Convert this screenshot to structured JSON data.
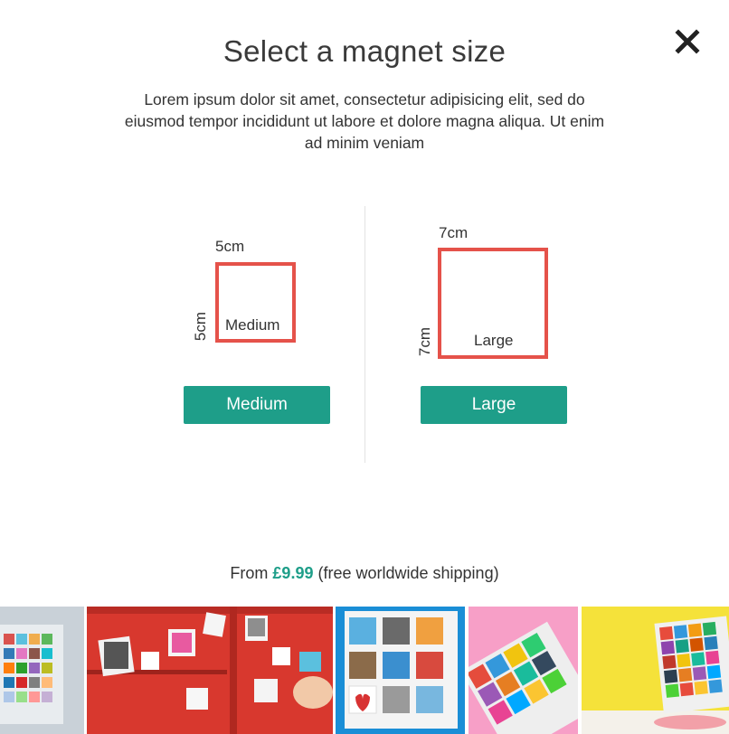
{
  "modal": {
    "title": "Select a magnet size",
    "description": "Lorem ipsum dolor sit amet, consectetur adipisicing elit, sed do eiusmod tempor incididunt ut labore et dolore magna aliqua. Ut enim ad minim veniam"
  },
  "options": {
    "medium": {
      "width_label": "5cm",
      "height_label": "5cm",
      "box_label": "Medium",
      "button_label": "Medium"
    },
    "large": {
      "width_label": "7cm",
      "height_label": "7cm",
      "box_label": "Large",
      "button_label": "Large"
    }
  },
  "pricing": {
    "prefix": "From",
    "amount": "£9.99",
    "suffix": "(free worldwide shipping)"
  },
  "colors": {
    "accent": "#1e9e89",
    "outline": "#e5524a"
  },
  "icons": {
    "close": "close-icon"
  }
}
